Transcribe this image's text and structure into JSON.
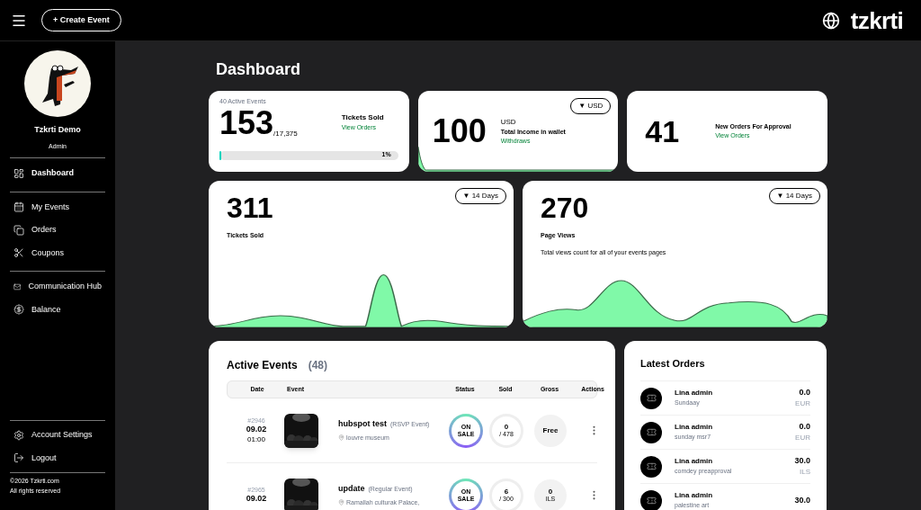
{
  "header": {
    "create_button": "+ Create Event",
    "logo": "tzkrti"
  },
  "sidebar": {
    "user_name": "Tzkrti Demo",
    "role": "Admin",
    "groups": [
      [
        {
          "label": "Dashboard",
          "selected": true
        }
      ],
      [
        {
          "label": "My Events",
          "selected": false
        },
        {
          "label": "Orders",
          "selected": false
        },
        {
          "label": "Coupons",
          "selected": false
        }
      ],
      [
        {
          "label": "Communication Hub",
          "selected": false
        },
        {
          "label": "Balance",
          "selected": false
        }
      ]
    ],
    "bottom": [
      {
        "label": "Account Settings"
      },
      {
        "label": "Logout"
      }
    ],
    "copyright": "©2026 Tzkrti.com",
    "rights": "All rights reserved"
  },
  "page_title": "Dashboard",
  "summary": {
    "tickets": {
      "caption": "40 Active Events",
      "value": "153",
      "total": "/17,375",
      "label": "Tickets Sold",
      "link": "View Orders",
      "level": 0.01,
      "percent": "1%"
    },
    "income": {
      "currency": "USD",
      "value": "100",
      "label": "Total Income in wallet",
      "link": "Withdraws",
      "dropdown": "▼ USD"
    },
    "orders": {
      "value": "41",
      "label": "New Orders For Approval",
      "link": "View Orders"
    }
  },
  "stats": [
    {
      "value": "311",
      "label": "Tickets Sold",
      "dropdown": "▼ 14 Days"
    },
    {
      "value": "270",
      "label": "Page Views",
      "description": "Total views count for all of your events pages",
      "dropdown": "▼ 14 Days"
    }
  ],
  "active_events": {
    "title": "Active Events",
    "count": "(48)",
    "columns": [
      "Date",
      "Event",
      "Status",
      "Sold",
      "Gross",
      "Actions"
    ],
    "rows": [
      {
        "id": "#2946",
        "date": "09.02",
        "time": "01:00",
        "name": "hubspot test",
        "type": "(RSVP Event)",
        "location": "louvre museum",
        "status": "ON SALE",
        "sold": "0",
        "capacity": "/ 478",
        "gross": "Free"
      },
      {
        "id": "#2965",
        "date": "09.02",
        "name": "update",
        "type": "(Regular Event)",
        "location": "Ramallah culturak Palace,",
        "status": "ON SALE",
        "sold": "6",
        "capacity": "/ 300",
        "gross": "0",
        "currency": "ILS"
      }
    ]
  },
  "latest_orders": {
    "title": "Latest Orders",
    "items": [
      {
        "name": "Lina admin",
        "event": "Sundaay",
        "amount": "0.0",
        "currency": "EUR"
      },
      {
        "name": "Lina admin",
        "event": "sunday msr7",
        "amount": "0.0",
        "currency": "EUR"
      },
      {
        "name": "Lina admin",
        "event": "comdey preapproval",
        "amount": "30.0",
        "currency": "ILS"
      },
      {
        "name": "Lina admin",
        "event": "palestine art",
        "amount": "30.0"
      }
    ]
  }
}
